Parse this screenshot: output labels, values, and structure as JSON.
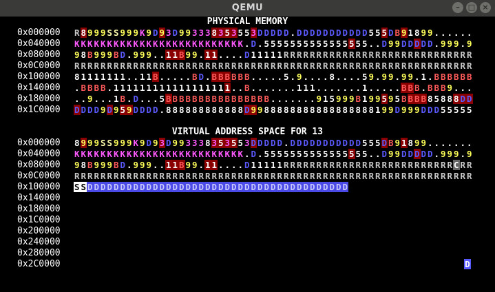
{
  "window": {
    "title": "QEMU",
    "buttons": [
      "–",
      "□",
      "×"
    ]
  },
  "palette": {
    "R": [
      "#c8c8c8",
      "#000"
    ],
    "D": [
      "#5a5aff",
      "#000"
    ],
    "B": [
      "#ff5a5a",
      "#000"
    ],
    "9": [
      "#ffff5a",
      "#000"
    ],
    "S": [
      "#ffffaa",
      "#000"
    ],
    "K": [
      "#ff5aff",
      "#000"
    ],
    "3": [
      "#ff5aff",
      "#5a0000"
    ],
    "5": [
      "#ffffff",
      "#000"
    ],
    "8": [
      "#ffffff",
      "#000"
    ],
    "1": [
      "#ffffff",
      "#000"
    ],
    ".": [
      "#ffffff",
      "#000"
    ],
    "Y": [
      "#ff5a5a",
      "#000"
    ],
    "C": [
      "#ffffff",
      "#555"
    ]
  },
  "physical": {
    "title": "PHYSICAL MEMORY",
    "rows": [
      {
        "addr": "0x000000",
        "text": "R8999SS999K9D93D99333835355 3DDDDD.DDDDDDDDDDD555DB91899.........",
        "hl": [
          1,
          13,
          21,
          22,
          23,
          24,
          27,
          47,
          50
        ]
      },
      {
        "addr": "0x040000",
        "text": "KKKKKKKKKKKKKKKKKKKKKKKKKK.D.5555555555555555..D99DDDDD.999.999K",
        "hl": [
          42,
          52
        ]
      },
      {
        "addr": "0x080000",
        "text": "98B999BD.999..11B99.11....D11111RRRRRRRRRRRRRRRRRRRRRRRRRRRRRRRR",
        "hl": [
          14,
          15,
          16,
          20,
          21
        ]
      },
      {
        "addr": "0x0C0000",
        "text": "RRRRRRRRRRRRRRRRRRRRRRRRRRRRRRRRRRRRRRRRRRRRRRRRRRRRRRRRRRRRRRRR",
        "hl": []
      },
      {
        "addr": "0x100000",
        "text": "81111111..11B.....BD.BBBBBB.....5.9....8....59.99.99.1.BBBBBB...",
        "hl": [
          12,
          21,
          22,
          23
        ]
      },
      {
        "addr": "0x140000",
        "text": ".BBBB.111111111111111111..B.......111.......1.....BBB.BBB9.......",
        "hl": [
          23,
          50,
          51
        ]
      },
      {
        "addr": "0x180000",
        "text": "..9...1B.D...5BBBBBBBBBBBBBBBB.......915999B199595BBBB85888DDD",
        "hl": [
          14,
          47,
          51,
          52,
          53,
          58,
          59,
          60
        ]
      },
      {
        "addr": "0x1C0000",
        "text": "DDDD9D959DDDD.888888888888D9988888888888888888199D999DDD555555555555",
        "hl": [
          0,
          5,
          7,
          8,
          26,
          27
        ]
      }
    ]
  },
  "virtual": {
    "title": "VIRTUAL ADDRESS SPACE FOR 13",
    "rows": [
      {
        "addr": "0x000000",
        "text": " 8999SS999K9D93D99333835355 3DDDDD.DDDDDDDDDDD555DB91899.........",
        "hl": [
          1,
          13,
          21,
          22,
          23,
          24,
          27,
          47,
          50
        ]
      },
      {
        "addr": "0x040000",
        "text": "KKKKKKKKKKKKKKKKKKKKKKKKKK.D.5555555555555555..D99DDDDD.999.999K",
        "hl": [
          42,
          52
        ]
      },
      {
        "addr": "0x080000",
        "text": "98B999BD.999..11B99.11....D11111RRRRRRRRRRRRRRRRRRRRRRRRRRCRRRRRRR",
        "hl": [
          14,
          15,
          16,
          20,
          21
        ]
      },
      {
        "addr": "0x0C0000",
        "text": "RRRRRRRRRRRRRRRRRRRRRRRRRRRRRRRRRRRRRRRRRRRRRRRRRRRRRRRRRRRRRRRR",
        "hl": []
      },
      {
        "addr": "0x100000",
        "text": "SSDDDDDDDDDDDDDDDDDDDDDDDDDDDDDDDDDDDDDDDD",
        "hl": []
      },
      {
        "addr": "0x140000",
        "text": "",
        "hl": []
      },
      {
        "addr": "0x180000",
        "text": "",
        "hl": []
      },
      {
        "addr": "0x1C0000",
        "text": "",
        "hl": []
      },
      {
        "addr": "0x200000",
        "text": "",
        "hl": []
      },
      {
        "addr": "0x240000",
        "text": "",
        "hl": []
      },
      {
        "addr": "0x280000",
        "text": "",
        "hl": []
      },
      {
        "addr": "0x2C0000",
        "text": "",
        "hl": []
      }
    ],
    "cursor_char": "D"
  }
}
